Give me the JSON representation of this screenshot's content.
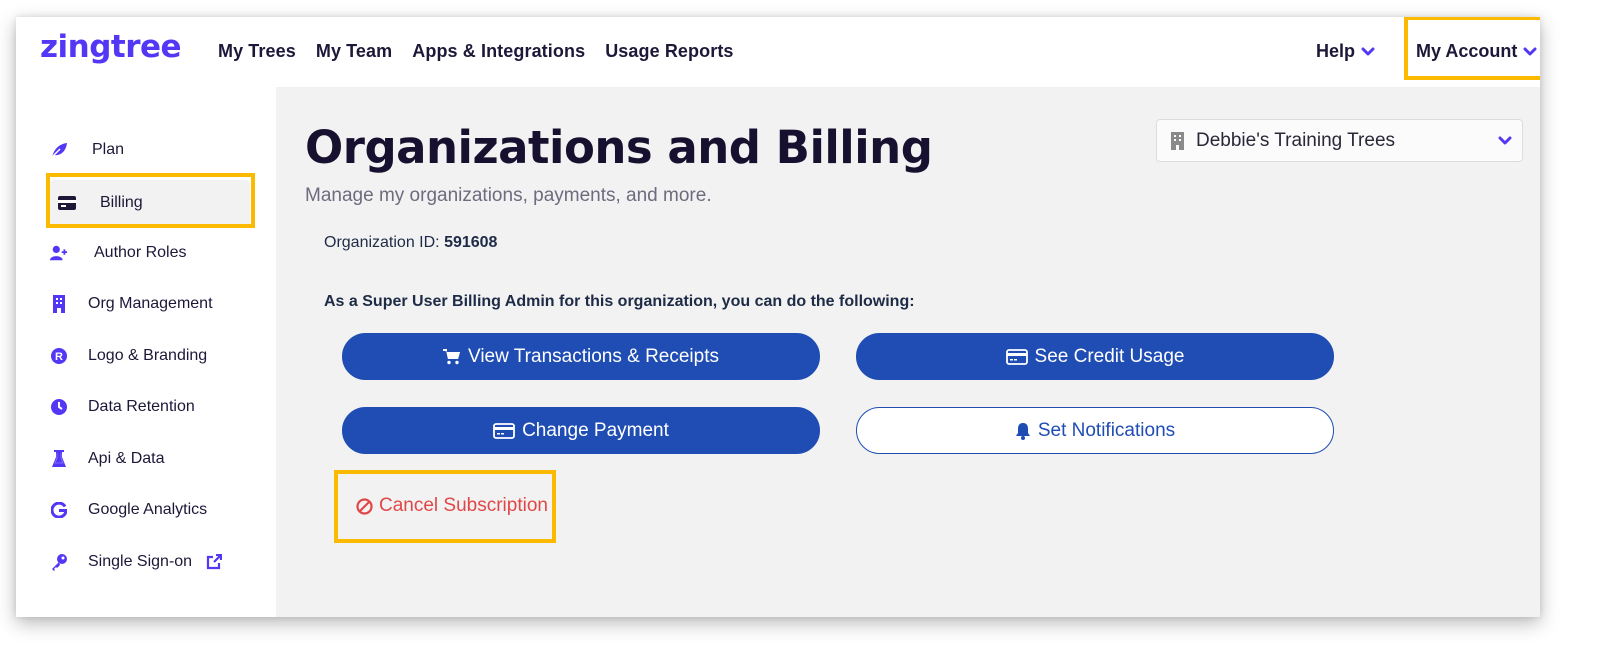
{
  "brand": {
    "logo_text": "zingtree",
    "accent_color": "#5237f5",
    "highlight_color": "#fbb900",
    "button_color": "#1f4db3",
    "danger_color": "#e04848"
  },
  "header": {
    "nav": [
      {
        "label": "My Trees"
      },
      {
        "label": "My Team"
      },
      {
        "label": "Apps & Integrations"
      },
      {
        "label": "Usage Reports"
      }
    ],
    "help_label": "Help",
    "account_label": "My Account"
  },
  "sidebar": {
    "items": [
      {
        "label": "Plan",
        "icon": "leaf-icon"
      },
      {
        "label": "Billing",
        "icon": "credit-card-icon",
        "active": true
      },
      {
        "label": "Author Roles",
        "icon": "user-plus-icon"
      },
      {
        "label": "Org Management",
        "icon": "building-icon"
      },
      {
        "label": "Logo & Branding",
        "icon": "registered-icon"
      },
      {
        "label": "Data Retention",
        "icon": "clock-icon"
      },
      {
        "label": "Api & Data",
        "icon": "flask-icon"
      },
      {
        "label": "Google Analytics",
        "icon": "google-icon"
      },
      {
        "label": "Single Sign-on",
        "icon": "key-icon",
        "external": true
      }
    ]
  },
  "main": {
    "title": "Organizations and Billing",
    "subtitle": "Manage my organizations, payments, and more.",
    "org_selector": {
      "value": "Debbie's Training Trees"
    },
    "org_id_label": "Organization ID: ",
    "org_id_value": "591608",
    "admin_text": "As a Super User Billing Admin for this organization, you can do the following:",
    "buttons": {
      "view_transactions": "View Transactions & Receipts",
      "see_credit_usage": "See Credit Usage",
      "change_payment": "Change Payment",
      "set_notifications": "Set Notifications"
    },
    "cancel_label": "Cancel Subscription"
  }
}
